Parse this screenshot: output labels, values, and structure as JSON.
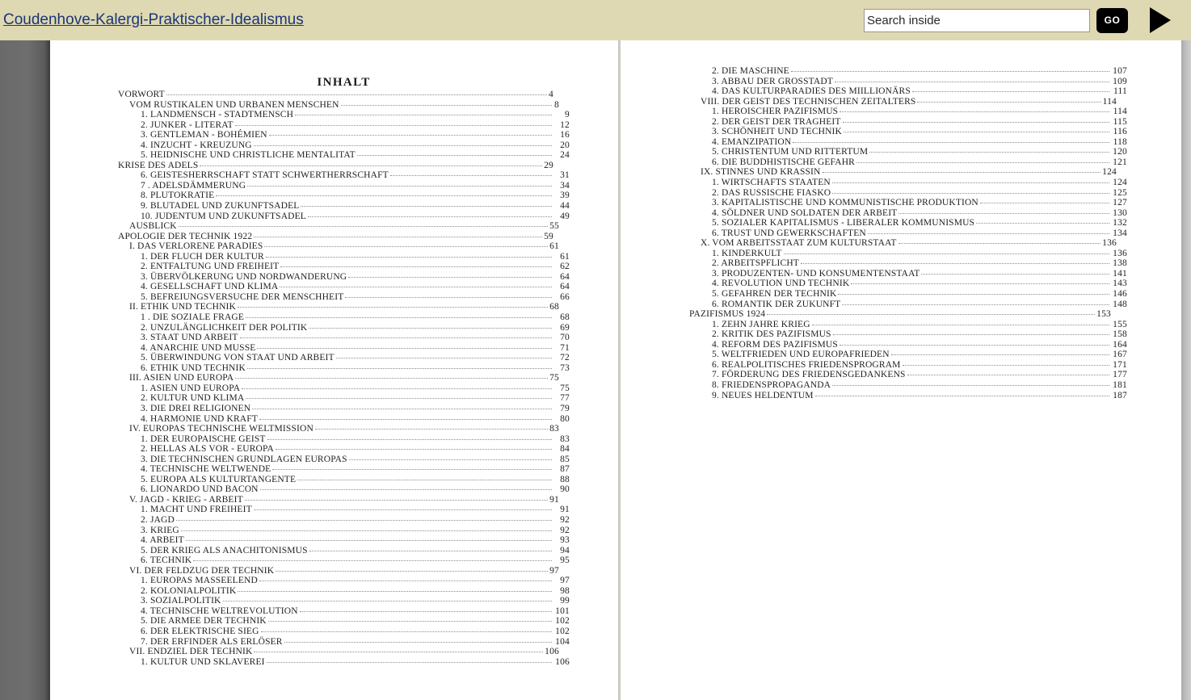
{
  "toolbar": {
    "book_title": "Coudenhove-Kalergi-Praktischer-Idealismus",
    "search_placeholder": "Search inside",
    "search_value": "",
    "go_label": "GO",
    "play_label": "play-button"
  },
  "colors": {
    "toolbar_bg": "#ded9b2",
    "link": "#1c3577",
    "button_bg": "#000000",
    "page_bg": "#ffffff",
    "gutter": "#6a6a6a"
  },
  "left_page": {
    "heading": "INHALT",
    "entries": [
      {
        "level": 0,
        "label": "VORWORT",
        "page": "4"
      },
      {
        "level": 1,
        "label": "VOM RUSTIKALEN UND URBANEN MENSCHEN",
        "page": "8"
      },
      {
        "level": 2,
        "label": "1. LANDMENSCH - STADTMENSCH",
        "page": "9"
      },
      {
        "level": 2,
        "label": "2. JUNKER - LITERAT",
        "page": "12"
      },
      {
        "level": 2,
        "label": "3. GENTLEMAN - BOHÉMIEN",
        "page": "16"
      },
      {
        "level": 2,
        "label": "4. INZUCHT - KREUZUNG",
        "page": "20"
      },
      {
        "level": 2,
        "label": "5. HEIDNISCHE UND CHRISTLICHE MENTALITAT",
        "page": "24"
      },
      {
        "level": 0,
        "label": "KRISE DES ADELS",
        "page": "29"
      },
      {
        "level": 2,
        "label": "6. GEISTESHERRSCHAFT STATT SCHWERTHERRSCHAFT",
        "page": "31"
      },
      {
        "level": 2,
        "label": "7 . ADELSDÄMMERUNG",
        "page": "34"
      },
      {
        "level": 2,
        "label": "8. PLUTOKRATIE",
        "page": "39"
      },
      {
        "level": 2,
        "label": "9. BLUTADEL UND ZUKUNFTSADEL",
        "page": "44"
      },
      {
        "level": 2,
        "label": "10. JUDENTUM UND ZUKUNFTSADEL",
        "page": "49"
      },
      {
        "level": 1,
        "label": "AUSBLICK",
        "page": "55"
      },
      {
        "level": 0,
        "label": "APOLOGIE DER TECHNIK 1922",
        "page": "59"
      },
      {
        "level": 1,
        "label": "I. DAS VERLORENE PARADIES",
        "page": "61"
      },
      {
        "level": 2,
        "label": "1. DER FLUCH DER KULTUR",
        "page": "61"
      },
      {
        "level": 2,
        "label": "2. ENTFALTUNG UND FREIHEIT",
        "page": "62"
      },
      {
        "level": 2,
        "label": "3. ÜBERVÖLKERUNG UND NORDWANDERUNG",
        "page": "64"
      },
      {
        "level": 2,
        "label": "4. GESELLSCHAFT UND KLIMA",
        "page": "64"
      },
      {
        "level": 2,
        "label": "5. BEFREIUNGSVERSUCHE DER MENSCHHEIT",
        "page": "66"
      },
      {
        "level": 1,
        "label": "II. ETHIK UND TECHNIK",
        "page": "68"
      },
      {
        "level": 2,
        "label": "1 . DIE SOZIALE FRAGE",
        "page": "68"
      },
      {
        "level": 2,
        "label": "2. UNZULÄNGLICHKEIT DER POLITIK",
        "page": "69"
      },
      {
        "level": 2,
        "label": "3. STAAT UND ARBEIT",
        "page": "70"
      },
      {
        "level": 2,
        "label": "4. ANARCHIE UND MUSSE",
        "page": "71"
      },
      {
        "level": 2,
        "label": "5. ÜBERWINDUNG VON STAAT UND ARBEIT",
        "page": "72"
      },
      {
        "level": 2,
        "label": "6. ETHIK UND TECHNIK",
        "page": "73"
      },
      {
        "level": 1,
        "label": "III. ASIEN UND EUROPA",
        "page": "75"
      },
      {
        "level": 2,
        "label": "1. ASIEN UND EUROPA",
        "page": "75"
      },
      {
        "level": 2,
        "label": "2. KULTUR UND KLIMA",
        "page": "77"
      },
      {
        "level": 2,
        "label": "3. DIE DREI RELIGIONEN",
        "page": "79"
      },
      {
        "level": 2,
        "label": "4. HARMONIE UND KRAFT",
        "page": "80"
      },
      {
        "level": 1,
        "label": "IV. EUROPAS TECHNISCHE WELTMISSION",
        "page": "83"
      },
      {
        "level": 2,
        "label": "1. DER EUROPAISCHE GEIST",
        "page": "83"
      },
      {
        "level": 2,
        "label": "2. HELLAS ALS VOR - EUROPA",
        "page": "84"
      },
      {
        "level": 2,
        "label": "3. DIE TECHNISCHEN GRUNDLAGEN EUROPAS",
        "page": "85"
      },
      {
        "level": 2,
        "label": "4. TECHNISCHE WELTWENDE",
        "page": "87"
      },
      {
        "level": 2,
        "label": "5. EUROPA ALS KULTURTANGENTE",
        "page": "88"
      },
      {
        "level": 2,
        "label": "6. LIONARDO UND BACON",
        "page": "90"
      },
      {
        "level": 1,
        "label": "V. JAGD - KRIEG - ARBEIT",
        "page": "91"
      },
      {
        "level": 2,
        "label": "1. MACHT UND FREIHEIT",
        "page": "91"
      },
      {
        "level": 2,
        "label": "2. JAGD",
        "page": "92"
      },
      {
        "level": 2,
        "label": "3. KRIEG",
        "page": "92"
      },
      {
        "level": 2,
        "label": "4. ARBEIT",
        "page": "93"
      },
      {
        "level": 2,
        "label": "5. DER KRIEG ALS ANACHITONISMUS",
        "page": "94"
      },
      {
        "level": 2,
        "label": "6. TECHNIK",
        "page": "95"
      },
      {
        "level": 1,
        "label": "VI. DER FELDZUG DER TECHNIK",
        "page": "97"
      },
      {
        "level": 2,
        "label": "1. EUROPAS MASSEELEND",
        "page": "97"
      },
      {
        "level": 2,
        "label": "2. KOLONIALPOLITIK",
        "page": "98"
      },
      {
        "level": 2,
        "label": "3. SOZIALPOLITIK",
        "page": "99"
      },
      {
        "level": 2,
        "label": "4. TECHNISCHE WELTREVOLUTION",
        "page": "101"
      },
      {
        "level": 2,
        "label": "5. DIE ARMEE DER TECHNIK",
        "page": "102"
      },
      {
        "level": 2,
        "label": "6. DER ELEKTRISCHE SIEG",
        "page": "102"
      },
      {
        "level": 2,
        "label": "7. DER ERFINDER ALS ERLÖSER",
        "page": "104"
      },
      {
        "level": 1,
        "label": "VII. ENDZIEL DER TECHNIK",
        "page": "106"
      },
      {
        "level": 2,
        "label": "1. KULTUR UND SKLAVEREI",
        "page": "106"
      }
    ]
  },
  "right_page": {
    "entries": [
      {
        "level": 2,
        "label": "2. DIE MASCHINE",
        "page": "107"
      },
      {
        "level": 2,
        "label": "3. ABBAU DER GROSSTADT",
        "page": "109"
      },
      {
        "level": 2,
        "label": "4. DAS KULTURPARADIES DES MIILLIONÄRS",
        "page": "111"
      },
      {
        "level": 1,
        "label": "VIII. DER GEIST DES TECHNISCHEN ZEITALTERS",
        "page": "114"
      },
      {
        "level": 2,
        "label": "1. HEROISCHER PAZIFISMUS",
        "page": "114"
      },
      {
        "level": 2,
        "label": "2. DER GEIST DER TRAGHEIT",
        "page": "115"
      },
      {
        "level": 2,
        "label": "3. SCHÖNHEIT UND TECHNIK",
        "page": "116"
      },
      {
        "level": 2,
        "label": "4. EMANZIPATION",
        "page": "118"
      },
      {
        "level": 2,
        "label": "5. CHRISTENTUM UND RITTERTUM",
        "page": "120"
      },
      {
        "level": 2,
        "label": "6. DIE BUDDHISTISCHE GEFAHR",
        "page": "121"
      },
      {
        "level": 1,
        "label": "IX. STINNES UND KRASSIN",
        "page": "124"
      },
      {
        "level": 2,
        "label": "1. WIRTSCHAFTS STAATEN",
        "page": "124"
      },
      {
        "level": 2,
        "label": "2. DAS RUSSISCHE FIASKO",
        "page": "125"
      },
      {
        "level": 2,
        "label": "3. KAPITALISTISCHE UND KOMMUNISTISCHE PRODUKTION",
        "page": "127"
      },
      {
        "level": 2,
        "label": "4. SÖLDNER UND SOLDATEN DER ARBEIT",
        "page": "130"
      },
      {
        "level": 2,
        "label": "5. SOZIALER KAPITALISMUS - LIBERALER KOMMUNISMUS",
        "page": "132"
      },
      {
        "level": 2,
        "label": "6. TRUST UND GEWERKSCHAFTEN",
        "page": "134"
      },
      {
        "level": 1,
        "label": "X. VOM ARBEITSSTAAT ZUM KULTURSTAAT",
        "page": "136"
      },
      {
        "level": 2,
        "label": "1. KINDERKULT",
        "page": "136"
      },
      {
        "level": 2,
        "label": "2. ARBEITSPFLICHT",
        "page": "138"
      },
      {
        "level": 2,
        "label": "3. PRODUZENTEN- UND KONSUMENTENSTAAT",
        "page": "141"
      },
      {
        "level": 2,
        "label": "4. REVOLUTION UND TECHNIK",
        "page": "143"
      },
      {
        "level": 2,
        "label": "5. GEFAHREN DER TECHNIK",
        "page": "146"
      },
      {
        "level": 2,
        "label": "6. ROMANTIK DER ZUKUNFT",
        "page": "148"
      },
      {
        "level": 0,
        "label": "PAZIFISMUS 1924",
        "page": "153"
      },
      {
        "level": 2,
        "label": "1. ZEHN JAHRE KRIEG",
        "page": "155"
      },
      {
        "level": 2,
        "label": "2. KRITIK DES PAZIFISMUS",
        "page": "158"
      },
      {
        "level": 2,
        "label": "4. REFORM DES PAZIFISMUS",
        "page": "164"
      },
      {
        "level": 2,
        "label": "5. WELTFRIEDEN UND EUROPAFRIEDEN",
        "page": "167"
      },
      {
        "level": 2,
        "label": "6. REALPOLITISCHES FRIEDENSPROGRAM",
        "page": "171"
      },
      {
        "level": 2,
        "label": "7. FÖRDERUNG DES FRIEDENSGEDANKENS",
        "page": "177"
      },
      {
        "level": 2,
        "label": "8. FRIEDENSPROPAGANDA",
        "page": "181"
      },
      {
        "level": 2,
        "label": "9. NEUES HELDENTUM",
        "page": "187"
      }
    ]
  }
}
